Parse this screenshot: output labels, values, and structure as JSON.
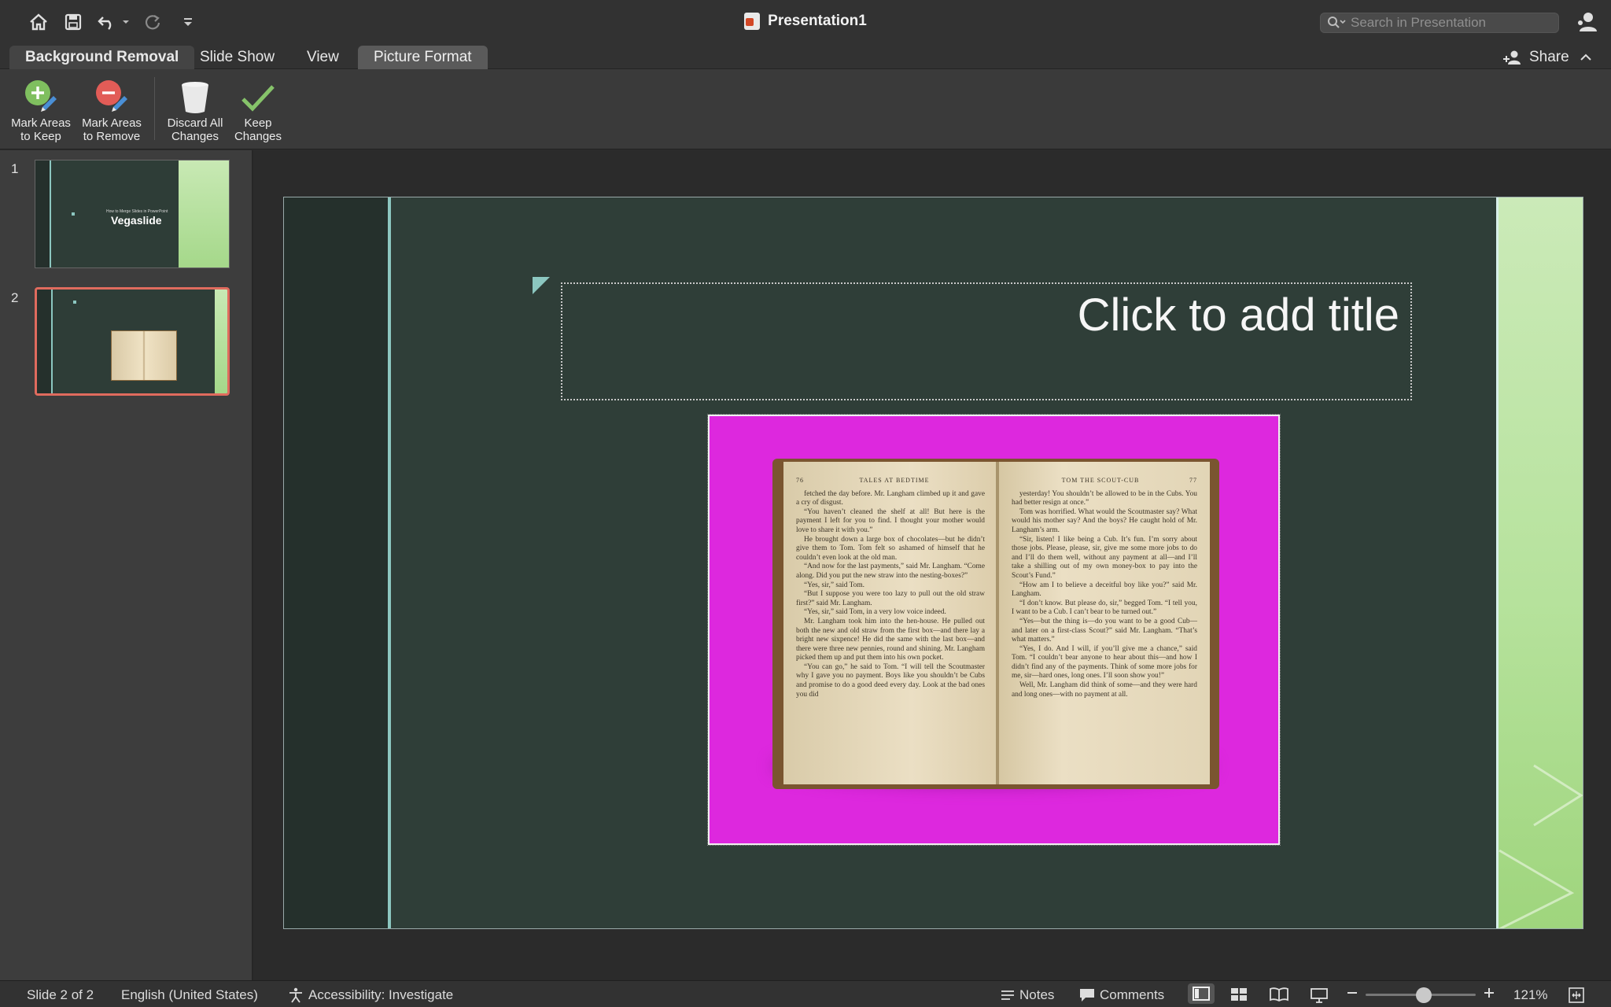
{
  "titlebar": {
    "document_title": "Presentation1",
    "search_placeholder": "Search in Presentation",
    "icons": [
      "home-icon",
      "save-icon",
      "undo-icon",
      "redo-icon",
      "customize-icon",
      "profile-icon"
    ]
  },
  "tabs": [
    {
      "label": "Background Removal",
      "state": "active"
    },
    {
      "label": "Slide Show",
      "state": "normal"
    },
    {
      "label": "View",
      "state": "normal"
    },
    {
      "label": "Picture Format",
      "state": "highlight"
    }
  ],
  "share_label": "Share",
  "ribbon": {
    "mark_keep": "Mark Areas to Keep",
    "mark_remove": "Mark Areas to Remove",
    "discard": "Discard All Changes",
    "keep": "Keep Changes"
  },
  "slides": [
    {
      "number": "1",
      "subtitle": "How to Merge Slides in PowerPoint",
      "title": "Vegaslide"
    },
    {
      "number": "2"
    }
  ],
  "slide": {
    "title_placeholder": "Click to add title"
  },
  "book": {
    "left_page_number": "76",
    "left_header": "TALES AT BEDTIME",
    "right_page_number": "77",
    "right_header": "TOM THE SCOUT-CUB",
    "left_text": [
      "fetched the day before. Mr. Langham climbed up it and gave a cry of disgust.",
      "“You haven’t cleaned the shelf at all! But here is the payment I left for you to find. I thought your mother would love to share it with you.”",
      "He brought down a large box of chocolates—but he didn’t give them to Tom. Tom felt so ashamed of himself that he couldn’t even look at the old man.",
      "“And now for the last payments,” said Mr. Langham. “Come along. Did you put the new straw into the nesting-boxes?”",
      "“Yes, sir,” said Tom.",
      "“But I suppose you were too lazy to pull out the old straw first?” said Mr. Langham.",
      "“Yes, sir,” said Tom, in a very low voice indeed.",
      "Mr. Langham took him into the hen-house. He pulled out both the new and old straw from the first box—and there lay a bright new sixpence! He did the same with the last box—and there were three new pennies, round and shining. Mr. Langham picked them up and put them into his own pocket.",
      "“You can go,” he said to Tom. “I will tell the Scoutmaster why I gave you no payment. Boys like you shouldn’t be Cubs and promise to do a good deed every day. Look at the bad ones you did"
    ],
    "right_text": [
      "yesterday! You shouldn’t be allowed to be in the Cubs. You had better resign at once.”",
      "Tom was horrified. What would the Scoutmaster say? What would his mother say? And the boys? He caught hold of Mr. Langham’s arm.",
      "“Sir, listen! I like being a Cub. It’s fun. I’m sorry about those jobs. Please, please, sir, give me some more jobs to do and I’ll do them well, without any payment at all—and I’ll take a shilling out of my own money-box to pay into the Scout’s Fund.”",
      "“How am I to believe a deceitful boy like you?” said Mr. Langham.",
      "“I don’t know. But please do, sir,” begged Tom. “I tell you, I want to be a Cub. I can’t bear to be turned out.”",
      "“Yes—but the thing is—do you want to be a good Cub—and later on a first-class Scout?” said Mr. Langham. “That’s what matters.”",
      "“Yes, I do. And I will, if you’ll give me a chance,” said Tom. “I couldn’t bear anyone to hear about this—and how I didn’t find any of the payments. Think of some more jobs for me, sir—hard ones, long ones. I’ll soon show you!”",
      "Well, Mr. Langham did think of some—and they were hard and long ones—with no payment at all."
    ]
  },
  "statusbar": {
    "slide_info": "Slide 2 of 2",
    "language": "English (United States)",
    "accessibility": "Accessibility: Investigate",
    "notes": "Notes",
    "comments": "Comments",
    "zoom": "121%"
  }
}
